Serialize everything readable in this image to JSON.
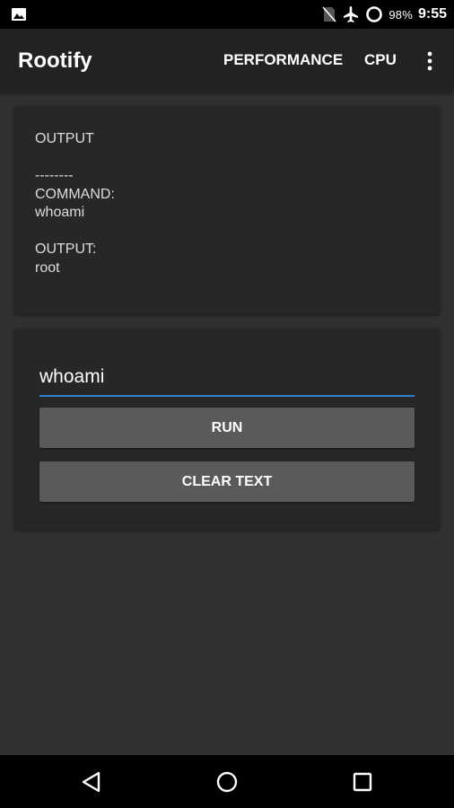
{
  "status_bar": {
    "battery_percent": "98%",
    "time": "9:55"
  },
  "app_bar": {
    "title": "Rootify",
    "actions": [
      {
        "label": "PERFORMANCE"
      },
      {
        "label": "CPU"
      }
    ],
    "overflow_icon": "more-vert-icon"
  },
  "output_card": {
    "text": "OUTPUT\n\n--------\nCOMMAND:\nwhoami\n\nOUTPUT:\nroot"
  },
  "command_input": {
    "value": "whoami"
  },
  "buttons": {
    "run_label": "RUN",
    "clear_label": "CLEAR TEXT"
  },
  "colors": {
    "accent": "#2f7fd3",
    "background": "#303030",
    "app_bar": "#222222",
    "card": "#272727",
    "button": "#5a5a5a"
  },
  "icons": {
    "status_left": "image-notification-icon",
    "status_right": [
      "no-sim-icon",
      "airplane-mode-icon",
      "battery-ring-icon"
    ],
    "nav": [
      "back-icon",
      "home-icon",
      "recents-icon"
    ]
  }
}
